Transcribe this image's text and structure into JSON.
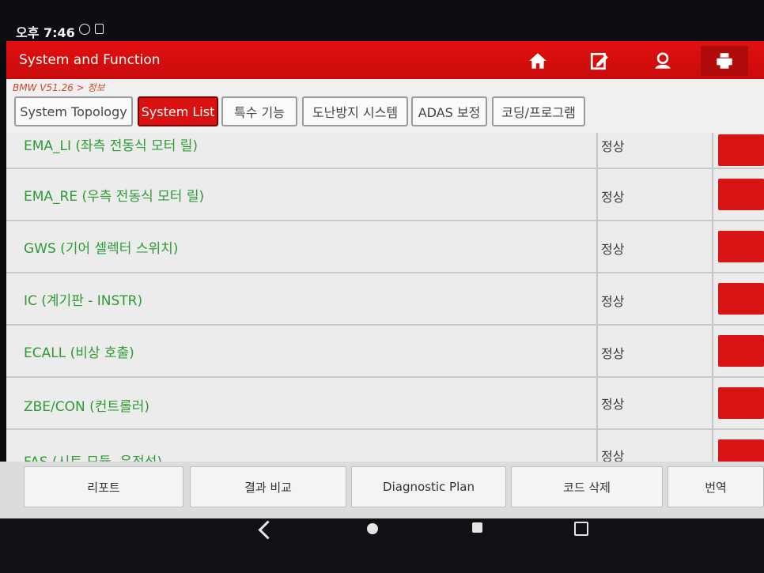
{
  "status_bar": {
    "time": "오후 7:46"
  },
  "header": {
    "title": "System and Function",
    "icons": [
      "home-icon",
      "edit-report-icon",
      "user-icon",
      "print-icon"
    ]
  },
  "breadcrumb": "BMW V51.26 > 정보",
  "tabs": [
    {
      "label": "System Topology",
      "active": false
    },
    {
      "label": "System List",
      "active": true
    },
    {
      "label": "특수 기능",
      "active": false
    },
    {
      "label": "도난방지 시스템",
      "active": false
    },
    {
      "label": "ADAS 보정",
      "active": false
    },
    {
      "label": "코딩/프로그램",
      "active": false
    }
  ],
  "systems": [
    {
      "name": "EMA_LI (좌측 전동식 모터 릴)",
      "status": "정상"
    },
    {
      "name": "EMA_RE (우측 전동식 모터 릴)",
      "status": "정상"
    },
    {
      "name": "GWS (기어 셀렉터 스위치)",
      "status": "정상"
    },
    {
      "name": "IC (계기판 - INSTR)",
      "status": "정상"
    },
    {
      "name": "ECALL (비상 호출)",
      "status": "정상"
    },
    {
      "name": "ZBE/CON (컨트롤러)",
      "status": "정상"
    },
    {
      "name": "FAS (시트 모듈, 운전석)",
      "status": "정상"
    }
  ],
  "bottom_buttons": [
    "리포트",
    "결과 비교",
    "Diagnostic Plan",
    "코드 삭제",
    "번역"
  ],
  "colors": {
    "accent_red": "#d91111",
    "system_name_green": "#2e9b34"
  }
}
